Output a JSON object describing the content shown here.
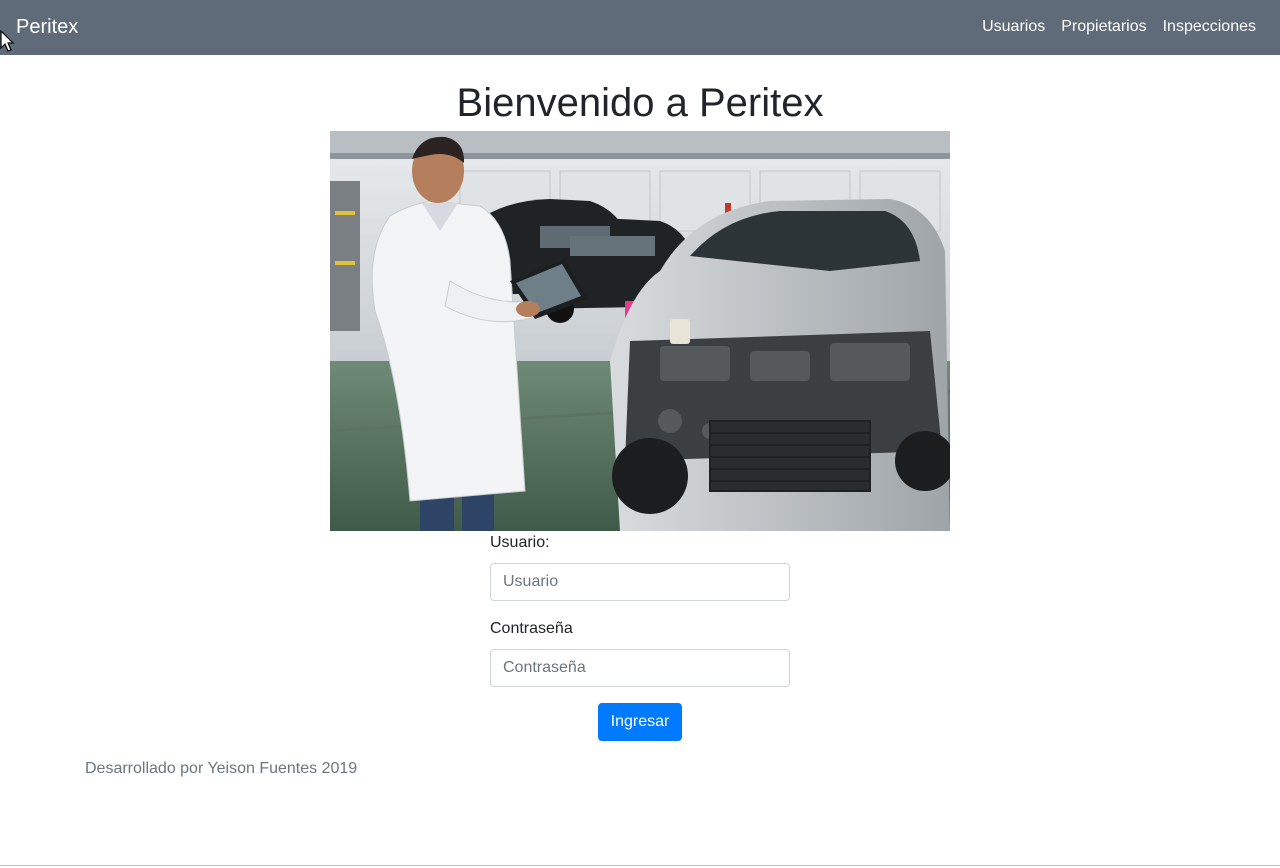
{
  "navbar": {
    "brand": "Peritex",
    "links": [
      "Usuarios",
      "Propietarios",
      "Inspecciones"
    ]
  },
  "main": {
    "title": "Bienvenido a Peritex",
    "hero_image": "inspector-with-tablet-and-damaged-car-photo"
  },
  "login_form": {
    "user_label": "Usuario:",
    "user_placeholder": "Usuario",
    "user_value": "",
    "password_label": "Contraseña",
    "password_placeholder": "Contraseña",
    "password_value": "",
    "submit_label": "Ingresar"
  },
  "footer": {
    "text": "Desarrollado por Yeison Fuentes 2019"
  },
  "colors": {
    "navbar_bg": "#5f6b78",
    "primary": "#007bff",
    "muted": "#6c757d"
  }
}
